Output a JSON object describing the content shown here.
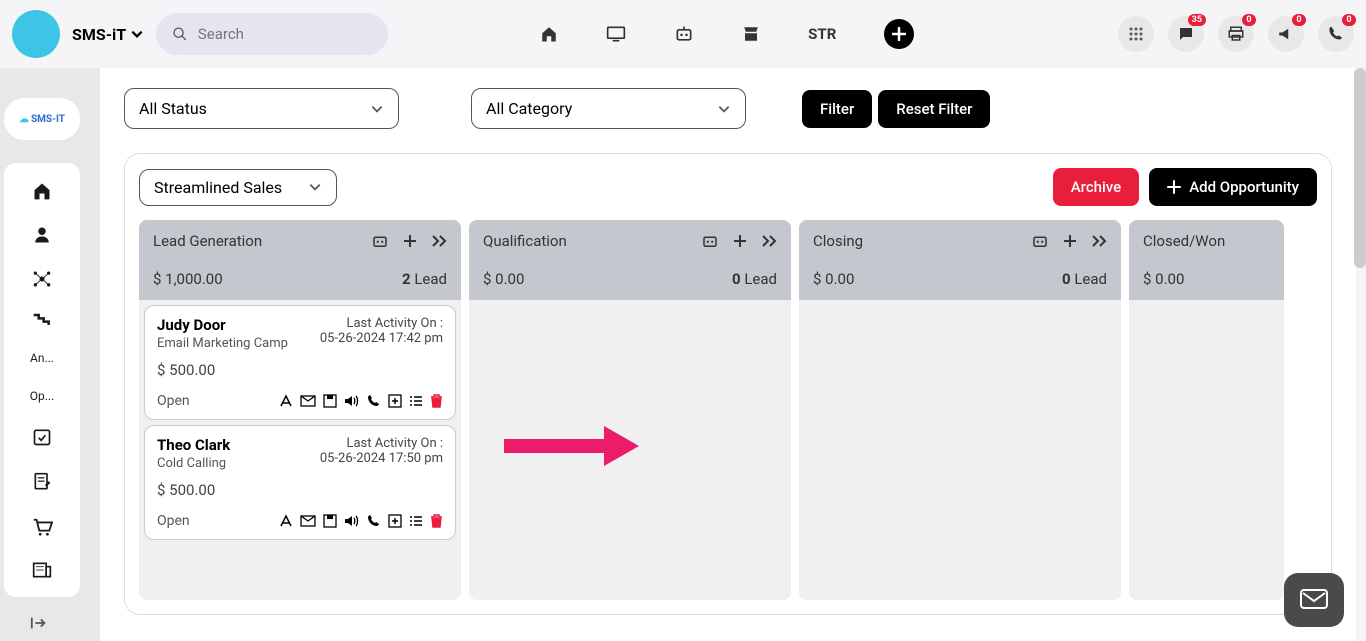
{
  "header": {
    "brand": "SMS-iT",
    "search_placeholder": "Search",
    "str_label": "STR",
    "badges": {
      "chat": "35",
      "print": "0",
      "announce": "0",
      "phone": "0"
    }
  },
  "sidebar": {
    "logo_text": "SMS-IT",
    "items": [
      {
        "label": ""
      },
      {
        "label": ""
      },
      {
        "label": ""
      },
      {
        "label": ""
      },
      {
        "label": "An..."
      },
      {
        "label": "Op..."
      },
      {
        "label": ""
      },
      {
        "label": ""
      },
      {
        "label": ""
      },
      {
        "label": ""
      }
    ]
  },
  "filters": {
    "status_label": "All Status",
    "category_label": "All Category",
    "filter_btn": "Filter",
    "reset_btn": "Reset Filter"
  },
  "board": {
    "pipeline_label": "Streamlined Sales ",
    "archive_btn": "Archive",
    "add_btn": "Add Opportunity",
    "columns": [
      {
        "title": "Lead Generation",
        "amount": "$ 1,000.00",
        "lead_count": "2",
        "lead_label": " Lead",
        "cards": [
          {
            "name": "Judy Door",
            "sub": "Email Marketing Camp",
            "activity_label": "Last Activity On :",
            "activity_date": "05-26-2024 17:42 pm",
            "amount": "$ 500.00",
            "status": "Open"
          },
          {
            "name": "Theo Clark",
            "sub": "Cold Calling",
            "activity_label": "Last Activity On :",
            "activity_date": "05-26-2024 17:50 pm",
            "amount": "$ 500.00",
            "status": "Open"
          }
        ]
      },
      {
        "title": "Qualification",
        "amount": "$ 0.00",
        "lead_count": "0",
        "lead_label": " Lead",
        "cards": []
      },
      {
        "title": "Closing",
        "amount": "$ 0.00",
        "lead_count": "0",
        "lead_label": " Lead",
        "cards": []
      },
      {
        "title": "Closed/Won",
        "amount": "$ 0.00",
        "lead_count": "",
        "lead_label": "",
        "cards": []
      }
    ]
  }
}
